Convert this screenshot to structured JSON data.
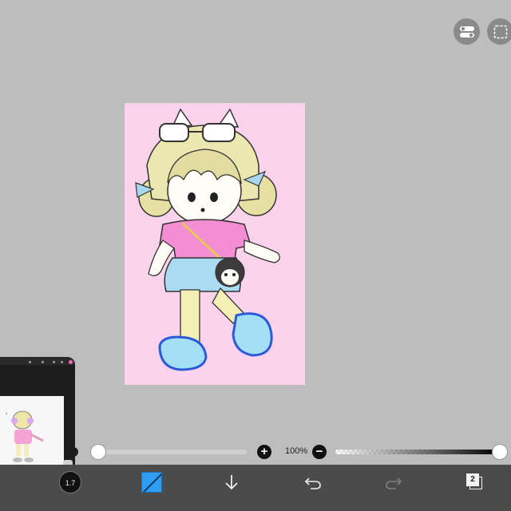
{
  "top_tools": [
    {
      "name": "toggle",
      "icon": "toggle-switch-icon"
    },
    {
      "name": "selection",
      "icon": "dashed-selection-icon"
    }
  ],
  "sliders": {
    "brush_size_plus": "+",
    "opacity_label": "100%",
    "opacity_minus": "−",
    "opacity_value": 100
  },
  "toolbar": {
    "brush_size": "1.7",
    "color": "#2f9df4",
    "layer_count": "2",
    "icons": [
      "brush-size-icon",
      "color-swatch-icon",
      "download-arrow-icon",
      "undo-icon",
      "redo-icon",
      "layers-icon"
    ]
  },
  "colors": {
    "canvas_bg": "#fcd3ec",
    "workspace": "#bdbdbd",
    "toolbar": "#4b4b4b"
  }
}
